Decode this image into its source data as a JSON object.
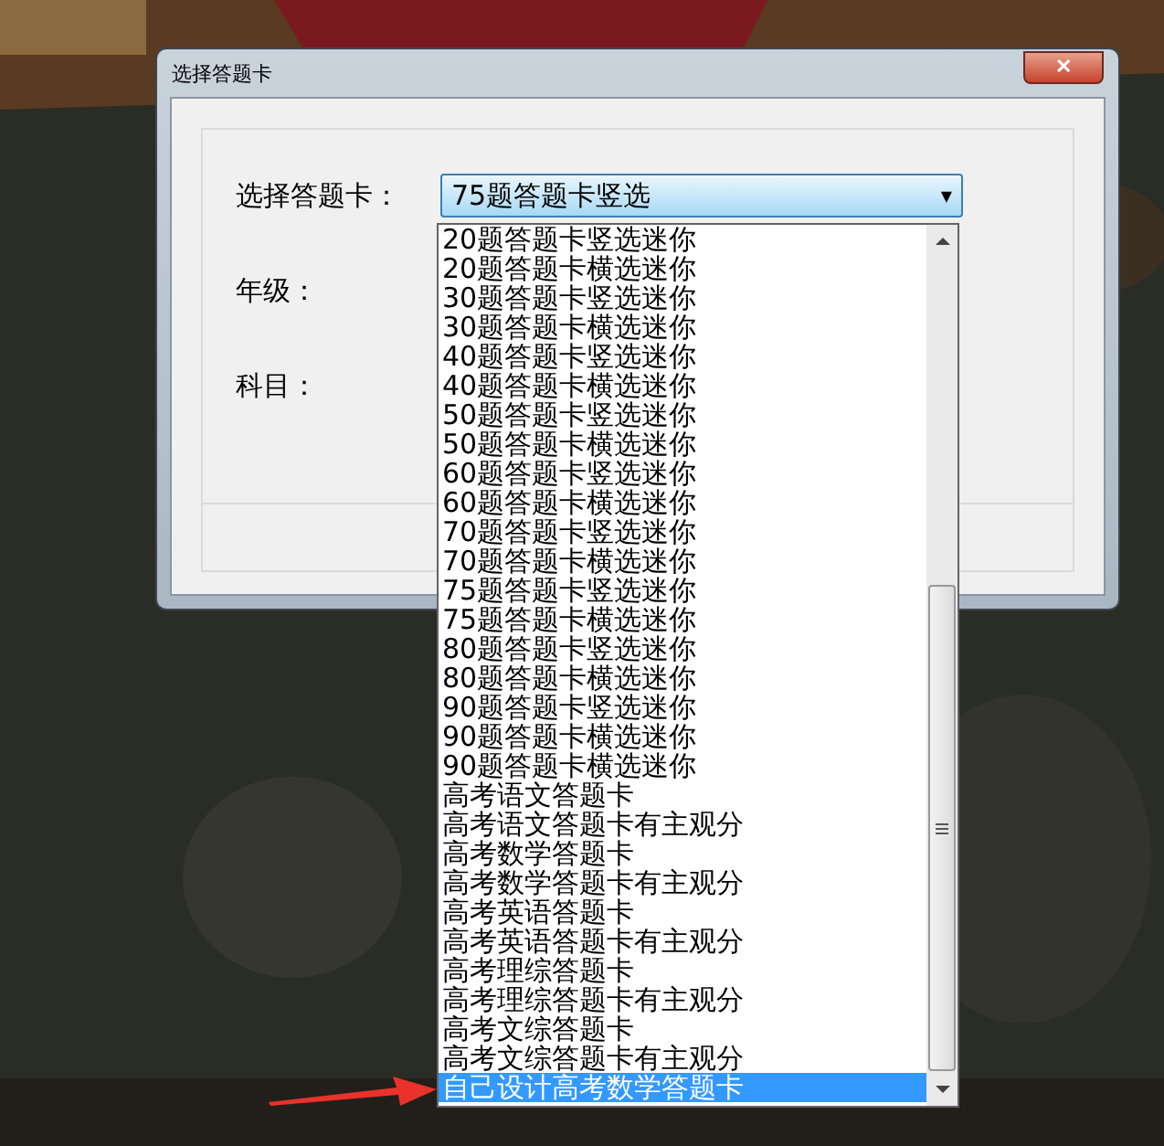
{
  "window": {
    "title": "选择答题卡",
    "close": "✕"
  },
  "fields": [
    {
      "kind": "combo",
      "label": "选择答题卡：",
      "value": "75题答题卡竖选",
      "arrow": "▼"
    },
    {
      "kind": "text",
      "label": "年级："
    },
    {
      "kind": "text",
      "label": "科目："
    }
  ],
  "dropdown": {
    "items": [
      {
        "label": "20题答题卡竖选迷你",
        "selected": false
      },
      {
        "label": "20题答题卡横选迷你",
        "selected": false
      },
      {
        "label": "30题答题卡竖选迷你",
        "selected": false
      },
      {
        "label": "30题答题卡横选迷你",
        "selected": false
      },
      {
        "label": "40题答题卡竖选迷你",
        "selected": false
      },
      {
        "label": "40题答题卡横选迷你",
        "selected": false
      },
      {
        "label": "50题答题卡竖选迷你",
        "selected": false
      },
      {
        "label": "50题答题卡横选迷你",
        "selected": false
      },
      {
        "label": "60题答题卡竖选迷你",
        "selected": false
      },
      {
        "label": "60题答题卡横选迷你",
        "selected": false
      },
      {
        "label": "70题答题卡竖选迷你",
        "selected": false
      },
      {
        "label": "70题答题卡横选迷你",
        "selected": false
      },
      {
        "label": "75题答题卡竖选迷你",
        "selected": false
      },
      {
        "label": "75题答题卡横选迷你",
        "selected": false
      },
      {
        "label": "80题答题卡竖选迷你",
        "selected": false
      },
      {
        "label": "80题答题卡横选迷你",
        "selected": false
      },
      {
        "label": "90题答题卡竖选迷你",
        "selected": false
      },
      {
        "label": "90题答题卡横选迷你",
        "selected": false
      },
      {
        "label": "90题答题卡横选迷你",
        "selected": false
      },
      {
        "label": "高考语文答题卡",
        "selected": false
      },
      {
        "label": "高考语文答题卡有主观分",
        "selected": false
      },
      {
        "label": "高考数学答题卡",
        "selected": false
      },
      {
        "label": "高考数学答题卡有主观分",
        "selected": false
      },
      {
        "label": "高考英语答题卡",
        "selected": false
      },
      {
        "label": "高考英语答题卡有主观分",
        "selected": false
      },
      {
        "label": "高考理综答题卡",
        "selected": false
      },
      {
        "label": "高考理综答题卡有主观分",
        "selected": false
      },
      {
        "label": "高考文综答题卡",
        "selected": false
      },
      {
        "label": "高考文综答题卡有主观分",
        "selected": false
      },
      {
        "label": "自己设计高考数学答题卡",
        "selected": true
      }
    ]
  },
  "annotation": {
    "kind": "arrow"
  }
}
